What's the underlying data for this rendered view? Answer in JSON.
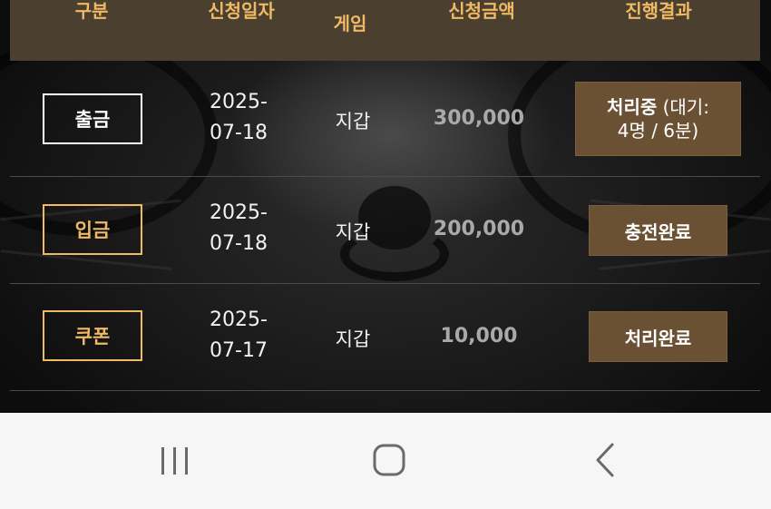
{
  "header": {
    "col_type": "구분",
    "col_date": "신청일자",
    "col_game_top": "",
    "col_game": "게임",
    "col_amount": "신청금액",
    "col_result": "진행결과"
  },
  "rows": [
    {
      "type": "출금",
      "date_line1": "2025-",
      "date_line2": "07-18",
      "game": "지갑",
      "amount": "300,000",
      "result_main": "처리중",
      "result_detail_1": " (대기:",
      "result_detail_2": "4명 / 6분)"
    },
    {
      "type": "입금",
      "date_line1": "2025-",
      "date_line2": "07-18",
      "game": "지갑",
      "amount": "200,000",
      "result_main": "충전완료"
    },
    {
      "type": "쿠폰",
      "date_line1": "2025-",
      "date_line2": "07-17",
      "game": "지갑",
      "amount": "10,000",
      "result_main": "처리완료"
    }
  ],
  "navbar": {
    "recents_icon": "recent-apps-icon",
    "home_icon": "home-icon",
    "back_icon": "back-icon"
  },
  "colors": {
    "header_bg": "#4b4030",
    "gold": "#f0b964",
    "result_bg": "#6b5134",
    "amount_text": "#a9a9a9"
  }
}
